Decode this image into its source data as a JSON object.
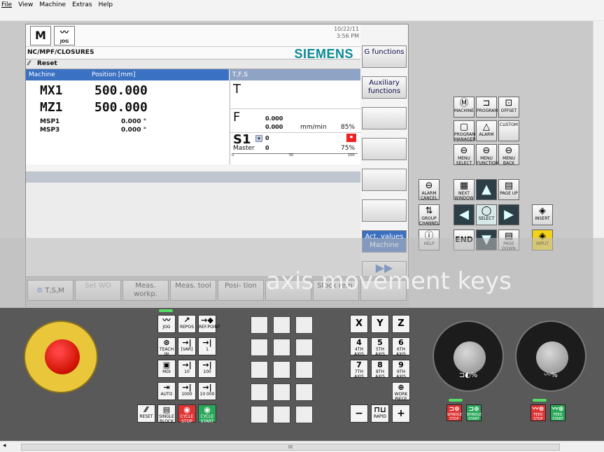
{
  "menu": [
    "File",
    "View",
    "Machine",
    "Extras",
    "Help"
  ],
  "top": {
    "machine_icon_label": "M",
    "jog_icon_label": "JOG",
    "date": "10/22/11",
    "time": "3:56 PM"
  },
  "path": "NC/MPF/CLOSURES",
  "brand": "SIEMENS",
  "reset_label": "Reset",
  "pos_header": {
    "machine": "Machine",
    "position": "Position [mm]"
  },
  "tfs_header": "T,F,S",
  "axes": [
    {
      "name": "MX1",
      "value": "500.000"
    },
    {
      "name": "MZ1",
      "value": "500.000"
    }
  ],
  "spindles": [
    {
      "name": "MSP1",
      "value": "0.000 °"
    },
    {
      "name": "MSP3",
      "value": "0.000 °"
    }
  ],
  "tfs": {
    "t_label": "T",
    "f_label": "F",
    "f_value1": "0.000",
    "f_value2": "0.000",
    "f_unit": "mm/min",
    "f_override": "85%",
    "s_label": "S1",
    "s_value": "0",
    "master_label": "Master",
    "master_value": "0",
    "s_override": "75%",
    "scale_0": "0",
    "scale_50": "50",
    "scale_100": "100"
  },
  "vsoft": [
    "G functions",
    "Auxiliary functions",
    "",
    "",
    "",
    "",
    "Act. values Machine",
    ""
  ],
  "hsoft": [
    {
      "label": "T,S,M",
      "enabled": true
    },
    {
      "label": "Set WO",
      "enabled": false
    },
    {
      "label": "Meas. workp.",
      "enabled": true
    },
    {
      "label": "Meas. tool",
      "enabled": true
    },
    {
      "label": "Posi- tion",
      "enabled": true
    },
    {
      "label": "",
      "enabled": true
    },
    {
      "label": "Stock rem.",
      "enabled": true
    }
  ],
  "overlay_text": "axis movement keys",
  "keys": {
    "machine": "MACHINE",
    "program": "PROGRAM",
    "offset": "OFFSET",
    "prog_manager": "PROGRAM MANAGER",
    "alarm": "ALARM",
    "custom": "CUSTOM",
    "menu_select": "MENU SELECT",
    "menu_function": "MENU FUNCTION",
    "menu_back": "MENU BACK",
    "alarm_cancel": "ALARM CANCEL",
    "next_window": "NEXT WINDOW",
    "page_up": "PAGE UP",
    "group_channel": "GROUP CHANNEL",
    "select": "SELECT",
    "insert": "INSERT",
    "help": "HELP",
    "end": "END",
    "page_down": "PAGE DOWN",
    "input": "INPUT"
  },
  "mcp": {
    "jog": "JOG",
    "repos": "REPOS",
    "ref_point": "REF.POINT",
    "teach_in": "TEACH IN",
    "var": "[VAR]",
    "inc1": "1",
    "mdi": "MDI",
    "inc10": "10",
    "inc100": "100",
    "auto": "AUTO",
    "inc1000": "1000",
    "inc10000": "10 000",
    "reset": "RESET",
    "single_block": "SINGLE BLOCK",
    "cycle_stop": "CYCLE STOP",
    "cycle_start": "CYCLE START",
    "x": "X",
    "y": "Y",
    "z": "Z",
    "ax4": "4",
    "ax5": "5",
    "ax6": "6",
    "ax7": "7",
    "ax8": "8",
    "ax9": "9",
    "axis_label": "4TH AXIS",
    "axis5_label": "5TH AXIS",
    "axis6_label": "6TH AXIS",
    "axis7_label": "7TH AXIS",
    "axis8_label": "8TH AXIS",
    "axis9_label": "9TH AXIS",
    "work_pos": "WORK PIECE",
    "minus": "−",
    "rapid": "RAPID",
    "plus": "+",
    "spindle_label": "% ",
    "feed_label": "%",
    "spindle_stop": "SPINDLE STOP",
    "spindle_start": "SPINDLE START",
    "feed_stop": "FEED STOP",
    "feed_start": "FEED START"
  },
  "dial1": {
    "label": "%",
    "ticks": [
      "50",
      "60",
      "70",
      "80",
      "90",
      "100",
      "110",
      "120"
    ]
  },
  "dial2": {
    "label": "%",
    "ticks": [
      "0",
      "2",
      "10",
      "30",
      "50",
      "60",
      "70",
      "75",
      "80",
      "85",
      "90",
      "95",
      "100",
      "105",
      "110",
      "115",
      "120"
    ]
  },
  "scroll_label": "III",
  "colors": {
    "brand": "#0b8a94",
    "header": "#3a71c2",
    "estop": "#e9c63a",
    "start": "#2aa85a",
    "stop": "#d33"
  }
}
